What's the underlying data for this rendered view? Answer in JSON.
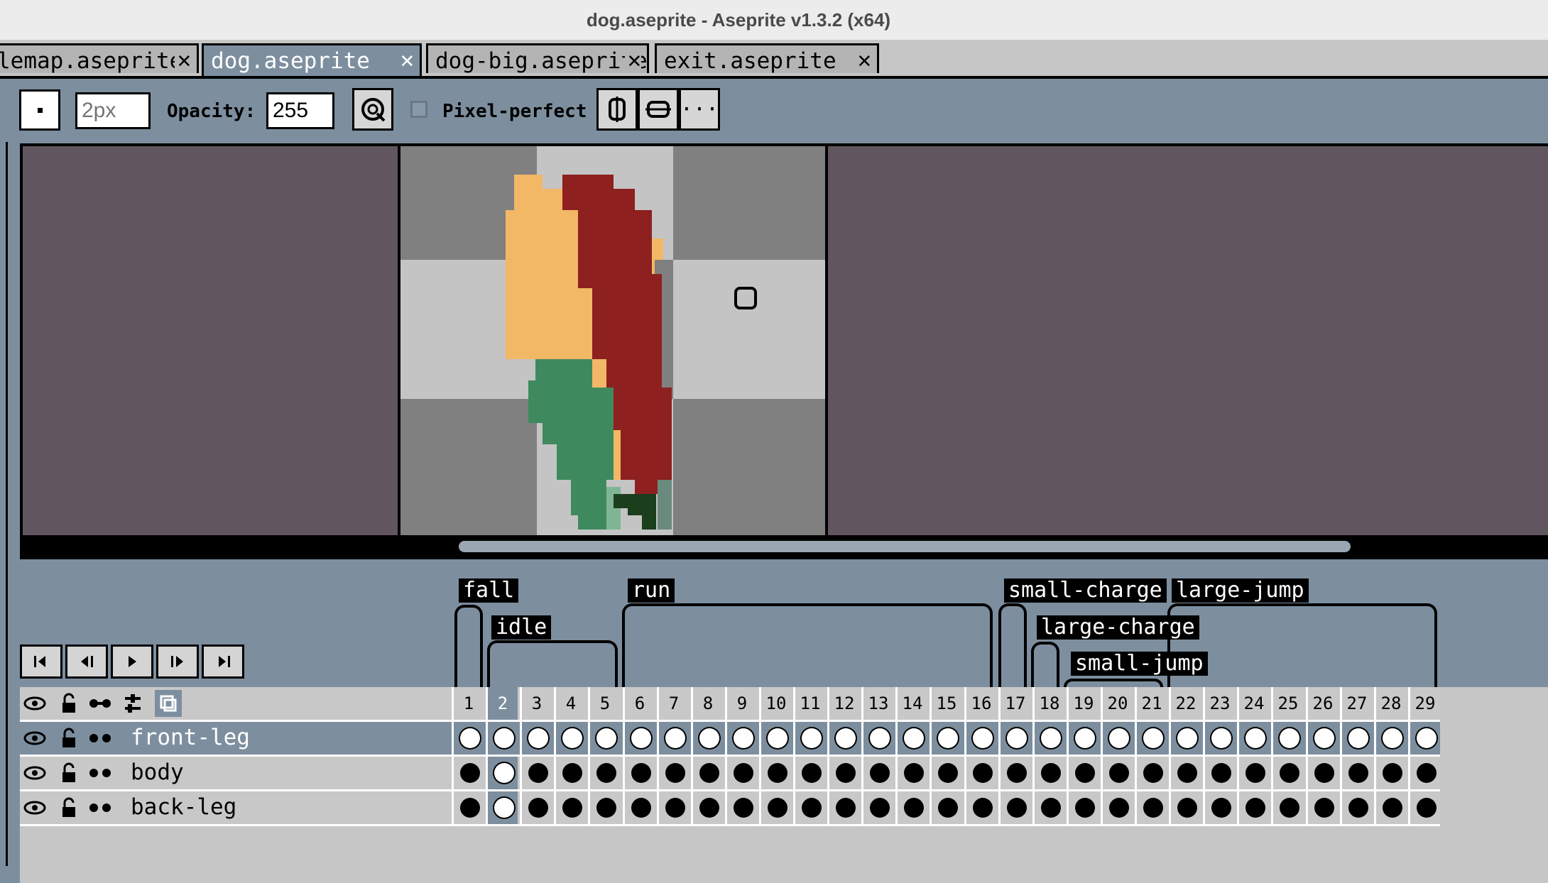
{
  "window": {
    "title": "dog.aseprite - Aseprite v1.3.2 (x64)"
  },
  "tabs": [
    {
      "label": "lemap.aseprite",
      "close": "✕"
    },
    {
      "label": "dog.aseprite",
      "close": "✕"
    },
    {
      "label": "dog-big.aseprite",
      "close": "✕"
    },
    {
      "label": "exit.aseprite",
      "close": "✕"
    }
  ],
  "context_bar": {
    "brush_size_placeholder": "2px",
    "opacity_label": "Opacity:",
    "opacity_value": "255",
    "pixel_perfect_label": "Pixel-perfect",
    "more_label": "···"
  },
  "timeline": {
    "tags": [
      {
        "name": "fall"
      },
      {
        "name": "idle"
      },
      {
        "name": "run"
      },
      {
        "name": "small-charge"
      },
      {
        "name": "large-jump"
      },
      {
        "name": "large-charge"
      },
      {
        "name": "small-jump"
      }
    ],
    "frames": [
      "1",
      "2",
      "3",
      "4",
      "5",
      "6",
      "7",
      "8",
      "9",
      "10",
      "11",
      "12",
      "13",
      "14",
      "15",
      "16",
      "17",
      "18",
      "19",
      "20",
      "21",
      "22",
      "23",
      "24",
      "25",
      "26",
      "27",
      "28",
      "29"
    ],
    "current_frame": "2",
    "layers": [
      {
        "name": "front-leg",
        "active": true
      },
      {
        "name": "body",
        "active": false
      },
      {
        "name": "back-leg",
        "active": false
      }
    ]
  },
  "colors": {
    "editor_bg": "#61555f",
    "ui_blue": "#7d8f9f",
    "sprite_orange": "#f2b866",
    "sprite_red": "#8e2020",
    "sprite_green": "#3e8a5e",
    "sprite_dark_green": "#1b3e1d"
  }
}
